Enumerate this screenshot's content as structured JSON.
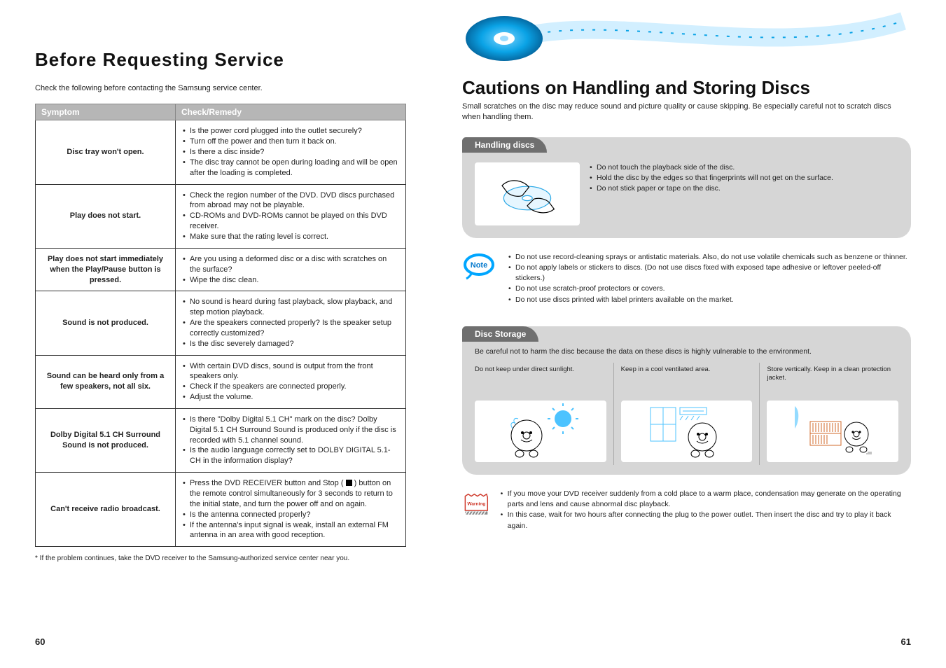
{
  "left": {
    "title": "Before Requesting Service",
    "intro": "Check the following before contacting the Samsung service center.",
    "table": {
      "h1": "Symptom",
      "h2": "Check/Remedy",
      "rows": [
        {
          "sym": "Disc tray won't open.",
          "rem": [
            "Is the power cord plugged into the outlet securely?",
            "Turn off the power and then turn it back on.",
            "Is there a disc inside?",
            "The disc tray cannot be open during loading and will be open after the loading is completed."
          ]
        },
        {
          "sym": "Play does not start.",
          "rem": [
            "Check the region number of the DVD. DVD discs purchased from abroad may not be playable.",
            "CD-ROMs and DVD-ROMs cannot be played on this DVD receiver.",
            "Make sure that the rating level is correct."
          ]
        },
        {
          "sym": "Play does not start immediately when the Play/Pause button is pressed.",
          "rem": [
            "Are you using a deformed disc or a disc with scratches on the surface?",
            "Wipe the disc clean."
          ]
        },
        {
          "sym": "Sound is not produced.",
          "rem": [
            "No sound is heard during fast playback, slow playback, and step motion playback.",
            "Are the speakers connected properly? Is the speaker setup correctly customized?",
            "Is the disc severely damaged?"
          ]
        },
        {
          "sym": "Sound can be heard only from a few speakers, not all six.",
          "rem": [
            "With certain DVD discs, sound is output from the front speakers only.",
            "Check if the speakers are connected properly.",
            "Adjust the volume."
          ]
        },
        {
          "sym": "Dolby Digital 5.1 CH Surround Sound is not produced.",
          "rem": [
            "Is there \"Dolby Digital 5.1 CH\" mark on the disc? Dolby Digital 5.1 CH Surround Sound is produced only if the disc is recorded with 5.1 channel sound.",
            "Is the audio language correctly set to DOLBY DIGITAL 5.1-CH in the information display?"
          ]
        },
        {
          "sym": "Can't receive radio broadcast.",
          "rem_prefix": "Press the DVD RECEIVER button and Stop (",
          "rem_suffix": ") button on the remote control simultaneously for 3 seconds to return to the initial state, and turn the power off and on again.",
          "rem": [
            "Is the antenna connected properly?",
            "If the antenna's input signal is weak, install an external FM antenna in an area with good reception."
          ]
        }
      ]
    },
    "footnote": "* If the problem continues, take the DVD receiver to the Samsung-authorized service center near you.",
    "page_num": "60"
  },
  "right": {
    "title": "Cautions on Handling and Storing Discs",
    "subtitle": "Small scratches on the disc may reduce sound and picture quality or cause skipping. Be especially careful not to scratch discs when handling them.",
    "panel1": {
      "header": "Handling discs",
      "illus_name": "hands-holding-disc",
      "lines": [
        "Do not touch the playback side of the disc.",
        "Hold the disc by the edges so that fingerprints will not get on the surface.",
        "Do not stick paper or tape on the disc."
      ]
    },
    "note": {
      "icon_name": "note-badge",
      "lines": [
        "Do not use record-cleaning sprays or antistatic materials. Also, do not use volatile chemicals such as benzene or thinner.",
        "Do not apply labels or stickers to discs. (Do not use discs fixed with exposed tape adhesive or leftover peeled-off stickers.)",
        "Do not use scratch-proof protectors or covers.",
        "Do not use discs printed with label printers available on the market."
      ]
    },
    "panel2": {
      "header": "Disc Storage",
      "intro": "Be careful not to harm the disc because the data on these discs is highly vulnerable to the environment.",
      "cells": [
        {
          "cap": "Do not keep under direct sunlight.",
          "icon": "disc-sunlight"
        },
        {
          "cap": "Keep in a cool ventilated area.",
          "icon": "disc-cool-area"
        },
        {
          "cap": "Store vertically. Keep in a clean protection jacket.",
          "icon": "disc-shelf"
        }
      ]
    },
    "warning": {
      "icon_name": "warning-badge",
      "lines": [
        "If you move your DVD receiver suddenly from a cold place to a warm place, condensation may generate on the operating parts and lens and cause abnormal disc playback.",
        "In this case, wait for two hours after connecting the plug to the power outlet. Then insert the disc and try to play it back again."
      ]
    },
    "page_num": "61"
  }
}
